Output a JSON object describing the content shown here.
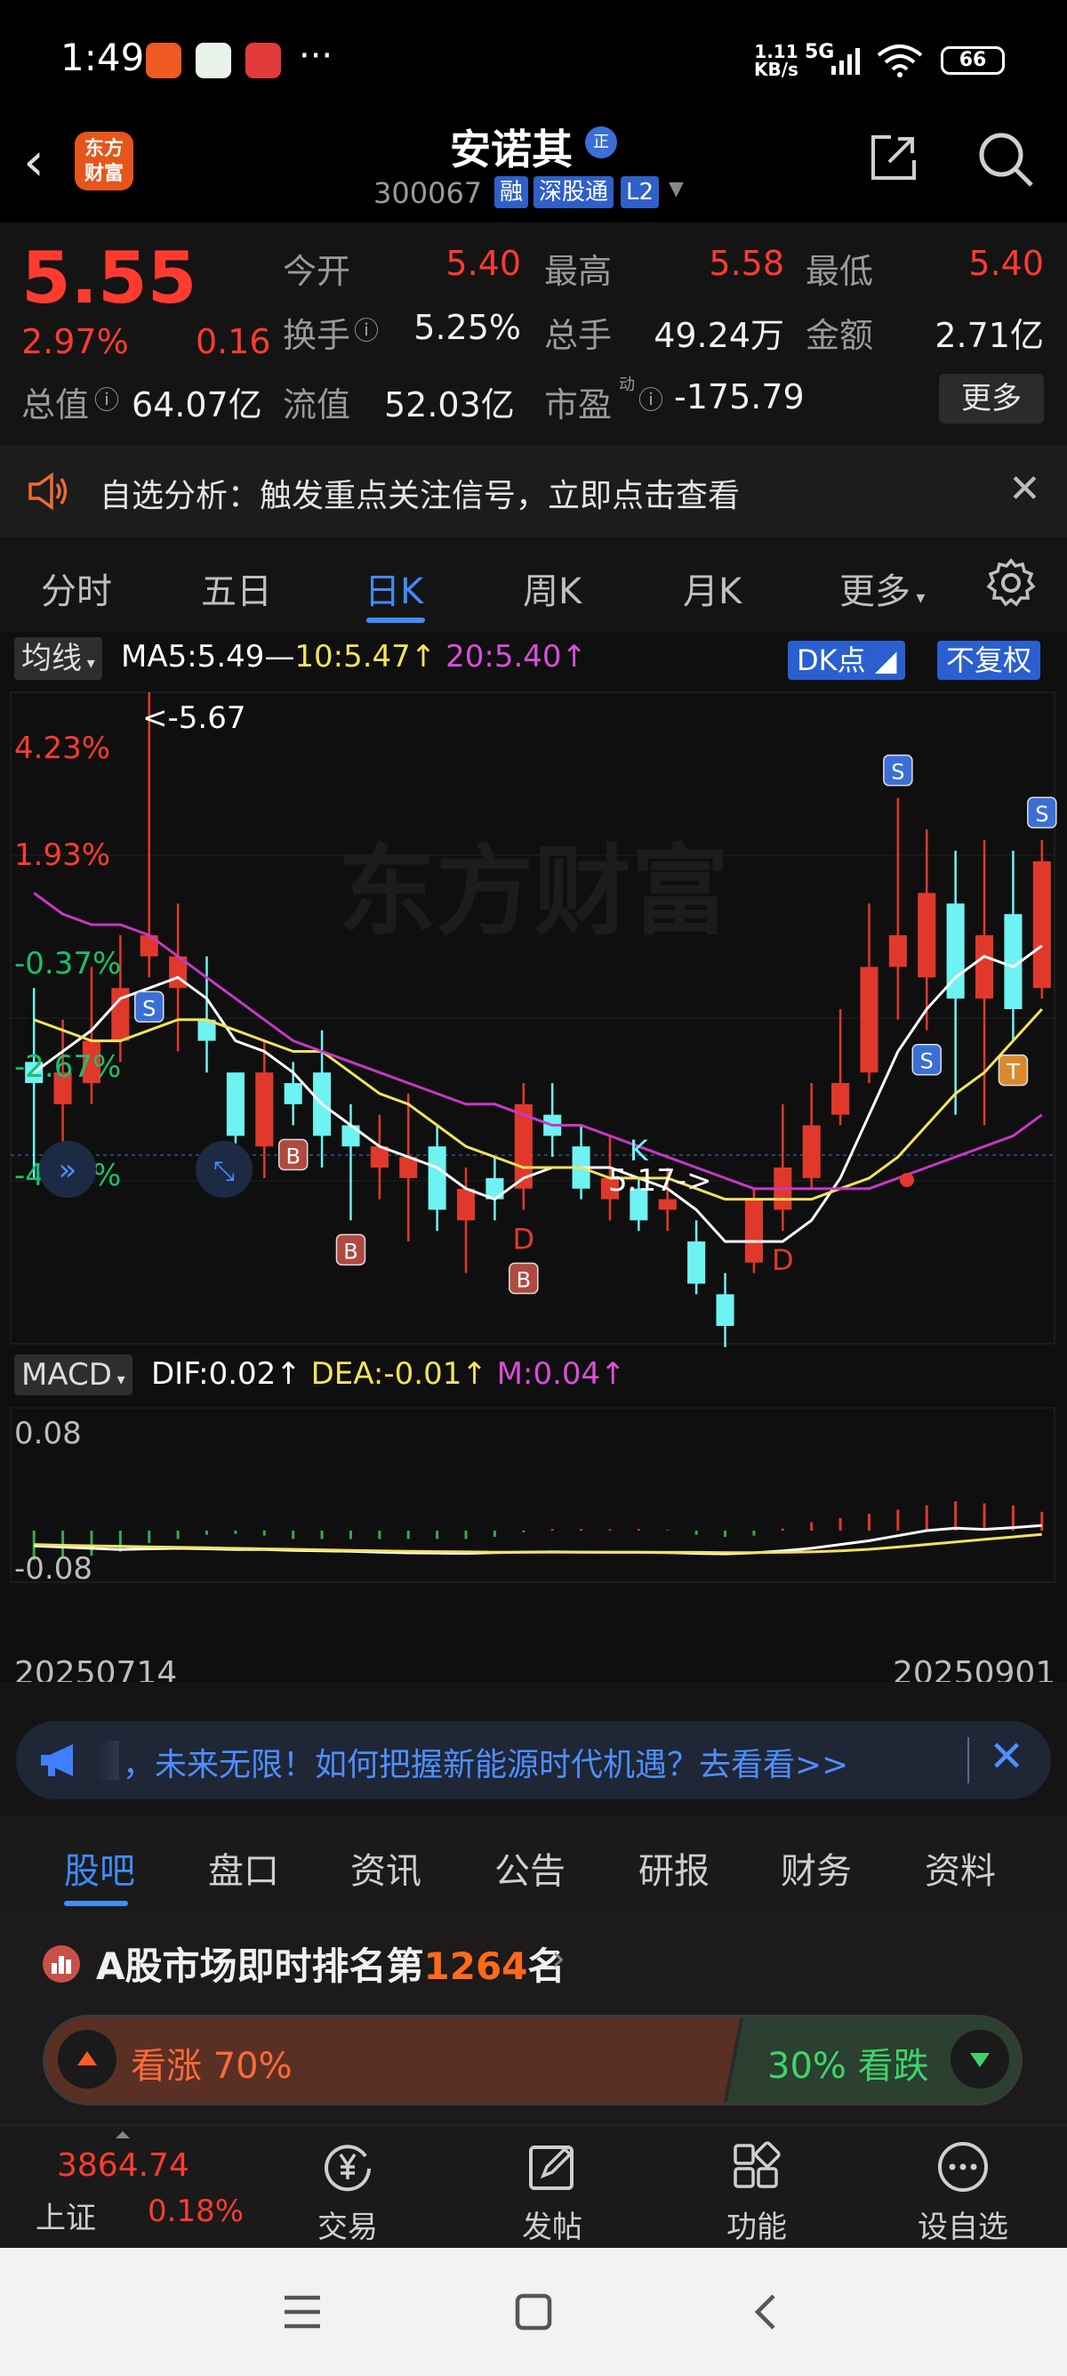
{
  "status_bar": {
    "time": "1:49",
    "dots": "···",
    "speed_top": "1.11",
    "speed_bottom": "KB/s",
    "network": "5G",
    "battery": "66"
  },
  "header": {
    "logo_top": "东方",
    "logo_bottom": "财富",
    "stock_name": "安诺其",
    "name_badge": "正",
    "code": "300067",
    "badges": [
      "融",
      "深股通",
      "L2"
    ]
  },
  "quote": {
    "price": "5.55",
    "change_pct": "2.97%",
    "change": "0.16",
    "rows": [
      [
        {
          "label": "今开",
          "value": "5.40",
          "color": "red"
        },
        {
          "label": "最高",
          "value": "5.58",
          "color": "red"
        },
        {
          "label": "最低",
          "value": "5.40",
          "color": "red"
        }
      ],
      [
        {
          "label": "换手",
          "value": "5.25%",
          "color": "white"
        },
        {
          "label": "总手",
          "value": "49.24万",
          "color": "white"
        },
        {
          "label": "金额",
          "value": "2.71亿",
          "color": "white"
        }
      ]
    ],
    "total_value_label": "总值",
    "total_value": "64.07亿",
    "float_label": "流值",
    "float_value": "52.03亿",
    "pe_label": "市盈",
    "pe_sup": "动",
    "pe_value": "-175.79",
    "more": "更多"
  },
  "alert": {
    "text": "自选分析：触发重点关注信号，立即点击查看"
  },
  "period_tabs": {
    "items": [
      "分时",
      "五日",
      "日K",
      "周K",
      "月K",
      "更多"
    ],
    "active": "日K"
  },
  "chart_labels": {
    "ma_button": "均线",
    "ma5": "MA5:5.49—",
    "ma10": "10:5.47↑",
    "ma20": "20:5.40↑",
    "dk": "DK点",
    "fuquan": "不复权",
    "macd_button": "MACD",
    "dif": "DIF:0.02↑",
    "dea": "DEA:-0.01↑",
    "m": "M:0.04↑",
    "high_mark": "<-5.67",
    "low_mark": "5.17->",
    "watermark": "东方财富",
    "date_start": "20250714",
    "date_end": "20250901"
  },
  "chart_data": {
    "type": "candlestick",
    "y_axis_labels": [
      "4.23%",
      "1.93%",
      "-0.37%",
      "-2.67%",
      "-4.96%"
    ],
    "y_axis_label_colors": [
      "#ff3b30",
      "#ff3b30",
      "#19c06a",
      "#19c06a",
      "#19c06a"
    ],
    "macd_axis_labels": [
      "0.08",
      "-0.08"
    ],
    "up_color": "#e0392b",
    "down_color": "#6ef2f2",
    "ma_colors": {
      "ma5": "#ffffff",
      "ma10": "#f2e35a",
      "ma20": "#c837c8"
    },
    "macd_colors": {
      "dif": "#ffffff",
      "dea": "#f2e35a",
      "bar_pos": "#e0392b",
      "bar_neg": "#3aa84a"
    },
    "candles": [
      {
        "o": 5.32,
        "c": 5.3,
        "h": 5.39,
        "l": 5.21
      },
      {
        "o": 5.28,
        "c": 5.31,
        "h": 5.36,
        "l": 5.2
      },
      {
        "o": 5.3,
        "c": 5.34,
        "h": 5.41,
        "l": 5.28
      },
      {
        "o": 5.34,
        "c": 5.39,
        "h": 5.44,
        "l": 5.32
      },
      {
        "o": 5.42,
        "c": 5.44,
        "h": 5.67,
        "l": 5.4
      },
      {
        "o": 5.39,
        "c": 5.42,
        "h": 5.47,
        "l": 5.33
      },
      {
        "o": 5.36,
        "c": 5.34,
        "h": 5.42,
        "l": 5.31
      },
      {
        "o": 5.31,
        "c": 5.25,
        "h": 5.31,
        "l": 5.23
      },
      {
        "o": 5.24,
        "c": 5.31,
        "h": 5.34,
        "l": 5.21
      },
      {
        "o": 5.3,
        "c": 5.28,
        "h": 5.32,
        "l": 5.26
      },
      {
        "o": 5.31,
        "c": 5.25,
        "h": 5.35,
        "l": 5.22
      },
      {
        "o": 5.26,
        "c": 5.24,
        "h": 5.28,
        "l": 5.17
      },
      {
        "o": 5.22,
        "c": 5.24,
        "h": 5.27,
        "l": 5.19
      },
      {
        "o": 5.21,
        "c": 5.23,
        "h": 5.29,
        "l": 5.15
      },
      {
        "o": 5.24,
        "c": 5.18,
        "h": 5.26,
        "l": 5.16
      },
      {
        "o": 5.17,
        "c": 5.2,
        "h": 5.22,
        "l": 5.12
      },
      {
        "o": 5.21,
        "c": 5.19,
        "h": 5.23,
        "l": 5.17
      },
      {
        "o": 5.2,
        "c": 5.28,
        "h": 5.3,
        "l": 5.18
      },
      {
        "o": 5.27,
        "c": 5.25,
        "h": 5.3,
        "l": 5.23
      },
      {
        "o": 5.24,
        "c": 5.2,
        "h": 5.26,
        "l": 5.19
      },
      {
        "o": 5.19,
        "c": 5.21,
        "h": 5.25,
        "l": 5.17
      },
      {
        "o": 5.2,
        "c": 5.17,
        "h": 5.21,
        "l": 5.16
      },
      {
        "o": 5.18,
        "c": 5.19,
        "h": 5.22,
        "l": 5.16
      },
      {
        "o": 5.15,
        "c": 5.11,
        "h": 5.17,
        "l": 5.1
      },
      {
        "o": 5.1,
        "c": 5.07,
        "h": 5.12,
        "l": 5.05
      },
      {
        "o": 5.13,
        "c": 5.19,
        "h": 5.2,
        "l": 5.12
      },
      {
        "o": 5.18,
        "c": 5.22,
        "h": 5.28,
        "l": 5.16
      },
      {
        "o": 5.21,
        "c": 5.26,
        "h": 5.3,
        "l": 5.2
      },
      {
        "o": 5.27,
        "c": 5.3,
        "h": 5.37,
        "l": 5.26
      },
      {
        "o": 5.31,
        "c": 5.41,
        "h": 5.47,
        "l": 5.3
      },
      {
        "o": 5.41,
        "c": 5.44,
        "h": 5.57,
        "l": 5.36
      },
      {
        "o": 5.4,
        "c": 5.48,
        "h": 5.54,
        "l": 5.35
      },
      {
        "o": 5.47,
        "c": 5.38,
        "h": 5.52,
        "l": 5.27
      },
      {
        "o": 5.38,
        "c": 5.44,
        "h": 5.53,
        "l": 5.26
      },
      {
        "o": 5.46,
        "c": 5.37,
        "h": 5.52,
        "l": 5.34
      },
      {
        "o": 5.39,
        "c": 5.51,
        "h": 5.53,
        "l": 5.38
      }
    ],
    "ma5": [
      5.31,
      5.33,
      5.35,
      5.38,
      5.39,
      5.4,
      5.38,
      5.34,
      5.33,
      5.31,
      5.28,
      5.26,
      5.24,
      5.23,
      5.22,
      5.2,
      5.19,
      5.21,
      5.22,
      5.22,
      5.22,
      5.21,
      5.2,
      5.18,
      5.15,
      5.15,
      5.15,
      5.17,
      5.21,
      5.27,
      5.33,
      5.37,
      5.4,
      5.42,
      5.41,
      5.43
    ],
    "ma10": [
      5.36,
      5.35,
      5.34,
      5.34,
      5.35,
      5.36,
      5.36,
      5.35,
      5.34,
      5.33,
      5.33,
      5.31,
      5.29,
      5.28,
      5.26,
      5.24,
      5.23,
      5.22,
      5.22,
      5.22,
      5.21,
      5.21,
      5.21,
      5.2,
      5.19,
      5.19,
      5.19,
      5.19,
      5.2,
      5.21,
      5.23,
      5.26,
      5.29,
      5.31,
      5.34,
      5.37
    ],
    "ma20": [
      5.48,
      5.46,
      5.45,
      5.45,
      5.44,
      5.42,
      5.4,
      5.38,
      5.36,
      5.34,
      5.33,
      5.32,
      5.31,
      5.3,
      5.29,
      5.28,
      5.28,
      5.27,
      5.26,
      5.26,
      5.25,
      5.24,
      5.23,
      5.22,
      5.21,
      5.2,
      5.2,
      5.2,
      5.2,
      5.2,
      5.21,
      5.22,
      5.23,
      5.24,
      5.25,
      5.27
    ],
    "signals": [
      {
        "index": 4,
        "label": "S",
        "where": "above"
      },
      {
        "index": 4,
        "label": "S",
        "where": "below"
      },
      {
        "index": 9,
        "label": "B",
        "where": "below"
      },
      {
        "index": 11,
        "label": "B",
        "where": "below"
      },
      {
        "index": 17,
        "label": "D",
        "where": "below"
      },
      {
        "index": 17,
        "label": "B",
        "where": "below"
      },
      {
        "index": 21,
        "label": "K",
        "where": "above"
      },
      {
        "index": 26,
        "label": "D",
        "where": "below"
      },
      {
        "index": 30,
        "label": "S",
        "where": "above"
      },
      {
        "index": 31,
        "label": "S",
        "where": "below"
      },
      {
        "index": 34,
        "label": "T",
        "where": "below"
      },
      {
        "index": 35,
        "label": "S",
        "where": "above"
      }
    ],
    "dif": [
      -0.06,
      -0.065,
      -0.07,
      -0.075,
      -0.072,
      -0.07,
      -0.072,
      -0.075,
      -0.075,
      -0.078,
      -0.08,
      -0.082,
      -0.085,
      -0.088,
      -0.089,
      -0.09,
      -0.087,
      -0.085,
      -0.084,
      -0.085,
      -0.086,
      -0.086,
      -0.087,
      -0.09,
      -0.092,
      -0.088,
      -0.08,
      -0.07,
      -0.055,
      -0.04,
      -0.02,
      0.0,
      0.01,
      0.005,
      0.012,
      0.02
    ],
    "dea": [
      -0.055,
      -0.058,
      -0.06,
      -0.062,
      -0.064,
      -0.066,
      -0.068,
      -0.07,
      -0.072,
      -0.074,
      -0.076,
      -0.078,
      -0.08,
      -0.082,
      -0.083,
      -0.084,
      -0.085,
      -0.085,
      -0.085,
      -0.085,
      -0.085,
      -0.085,
      -0.086,
      -0.086,
      -0.087,
      -0.087,
      -0.086,
      -0.084,
      -0.08,
      -0.074,
      -0.065,
      -0.055,
      -0.045,
      -0.035,
      -0.025,
      -0.015
    ],
    "macd": [
      -0.07,
      -0.065,
      -0.06,
      -0.05,
      -0.03,
      -0.02,
      -0.01,
      -0.008,
      -0.012,
      -0.02,
      -0.02,
      -0.02,
      -0.02,
      -0.02,
      -0.02,
      -0.02,
      -0.015,
      -0.004,
      0.004,
      0.004,
      0.003,
      0.004,
      0.002,
      -0.01,
      -0.015,
      -0.012,
      0.005,
      0.02,
      0.03,
      0.04,
      0.05,
      0.06,
      0.07,
      0.065,
      0.06,
      0.045
    ]
  },
  "banner": {
    "text": "，未来无限！如何把握新能源时代机遇？去看看>>"
  },
  "info_tabs": {
    "items": [
      "股吧",
      "盘口",
      "资讯",
      "公告",
      "研报",
      "财务",
      "资料"
    ],
    "active": "股吧"
  },
  "ranking": {
    "prefix": "A股市场即时排名第",
    "number": "1264",
    "suffix": "名"
  },
  "vote": {
    "up_label": "看涨 70%",
    "down_label": "30% 看跌",
    "up_fraction": 0.7
  },
  "bottom_bar": {
    "index_value": "3864.74",
    "index_name": "上证",
    "index_pct": "0.18%",
    "items": [
      {
        "label": "交易",
        "icon": "yen-circle-icon"
      },
      {
        "label": "发帖",
        "icon": "edit-icon"
      },
      {
        "label": "功能",
        "icon": "grid-icon"
      },
      {
        "label": "设自选",
        "icon": "more-circle-icon"
      }
    ]
  }
}
